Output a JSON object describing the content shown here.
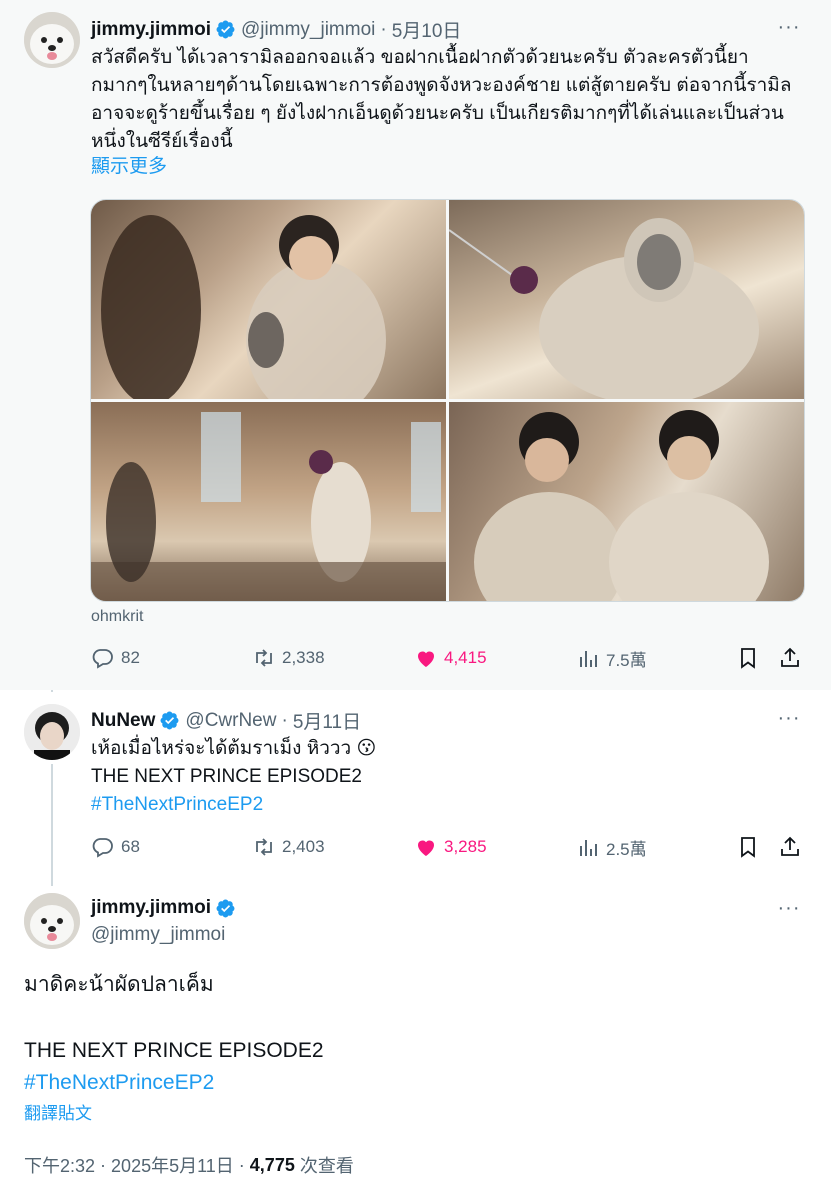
{
  "colors": {
    "accent": "#1d9bf0",
    "like": "#f91880",
    "muted": "#536471",
    "text": "#0f1419"
  },
  "tweet1": {
    "display_name": "jimmy.jimmoi",
    "handle": "@jimmy_jimmoi",
    "date": "5月10日",
    "text": "สวัสดีครับ ได้เวลารามิลออกจอแล้ว ขอฝากเนื้อฝากตัวด้วยนะครับ ตัวละครตัวนี้ยากมากๆในหลายๆด้านโดยเฉพาะการต้องพูดจังหวะองค์ชาย แต่สู้ตายครับ ต่อจากนี้รามิลอาจจะดูร้ายขึ้นเรื่อย ๆ ยังไงฝากเอ็นดูด้วยนะครับ เป็นเกียรติมากๆที่ได้เล่นและเป็นส่วนหนึ่งในซีรีย์เรื่องนี้",
    "show_more": "顯示更多",
    "media_caption": "ohmkrit",
    "replies": "82",
    "retweets": "2,338",
    "likes": "4,415",
    "views": "7.5萬"
  },
  "tweet2": {
    "display_name": "NuNew",
    "handle": "@CwrNew",
    "date": "5月11日",
    "line1": "เห้อเมื่อไหร่จะได้ต้มราเม็ง หิววว 😗",
    "line2": "THE NEXT PRINCE EPISODE2",
    "hashtag": "#TheNextPrinceEP2",
    "replies": "68",
    "retweets": "2,403",
    "likes": "3,285",
    "views": "2.5萬"
  },
  "tweet3": {
    "display_name": "jimmy.jimmoi",
    "handle": "@jimmy_jimmoi",
    "line1": "มาดิคะน้าผัดปลาเค็ม",
    "line2": "THE NEXT PRINCE EPISODE2",
    "hashtag": "#TheNextPrinceEP2",
    "translate": "翻譯貼文",
    "time": "下午2:32",
    "date": "2025年5月11日",
    "views_count": "4,775",
    "views_label": "次查看"
  }
}
